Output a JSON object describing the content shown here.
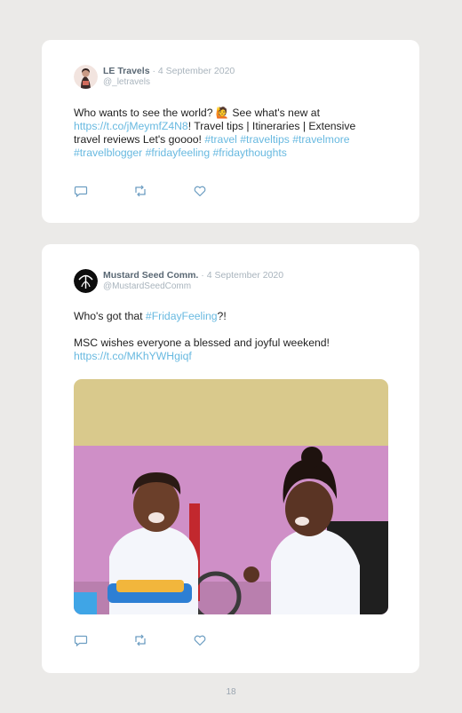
{
  "tweets": [
    {
      "name": "LE Travels",
      "date": " · 4 September 2020",
      "handle": "@_letravels",
      "lines": [
        [
          {
            "t": "Who wants to see the world? 🙋 See what's new at ",
            "link": false
          }
        ],
        [
          {
            "t": "https://t.co/jMeymfZ4N8",
            "link": true
          },
          {
            "t": "! Travel tips | Itineraries | Extensive",
            "link": false
          }
        ],
        [
          {
            "t": "travel reviews Let's goooo! ",
            "link": false
          },
          {
            "t": "#travel #traveltips #travelmore",
            "link": true
          }
        ],
        [
          {
            "t": "#travelblogger #fridayfeeling #fridaythoughts",
            "link": true
          }
        ]
      ]
    },
    {
      "name": "Mustard Seed Comm.",
      "date": " · 4 September 2020",
      "handle": "@MustardSeedComm",
      "lines": [
        [
          {
            "t": "Who's got that ",
            "link": false
          },
          {
            "t": "#FridayFeeling",
            "link": true
          },
          {
            "t": "?!",
            "link": false
          }
        ],
        [
          {
            "t": " ",
            "link": false
          }
        ],
        [
          {
            "t": "MSC wishes everyone a blessed and joyful weekend!",
            "link": false
          }
        ],
        [
          {
            "t": "https://t.co/MKhYWHgiqf",
            "link": true
          }
        ]
      ]
    }
  ],
  "icons": {
    "reply": "reply-icon",
    "retweet": "retweet-icon",
    "like": "heart-icon"
  },
  "colors": {
    "link": "#68b9e0",
    "background": "#ebeae8",
    "card": "#ffffff"
  },
  "page_number": "18"
}
